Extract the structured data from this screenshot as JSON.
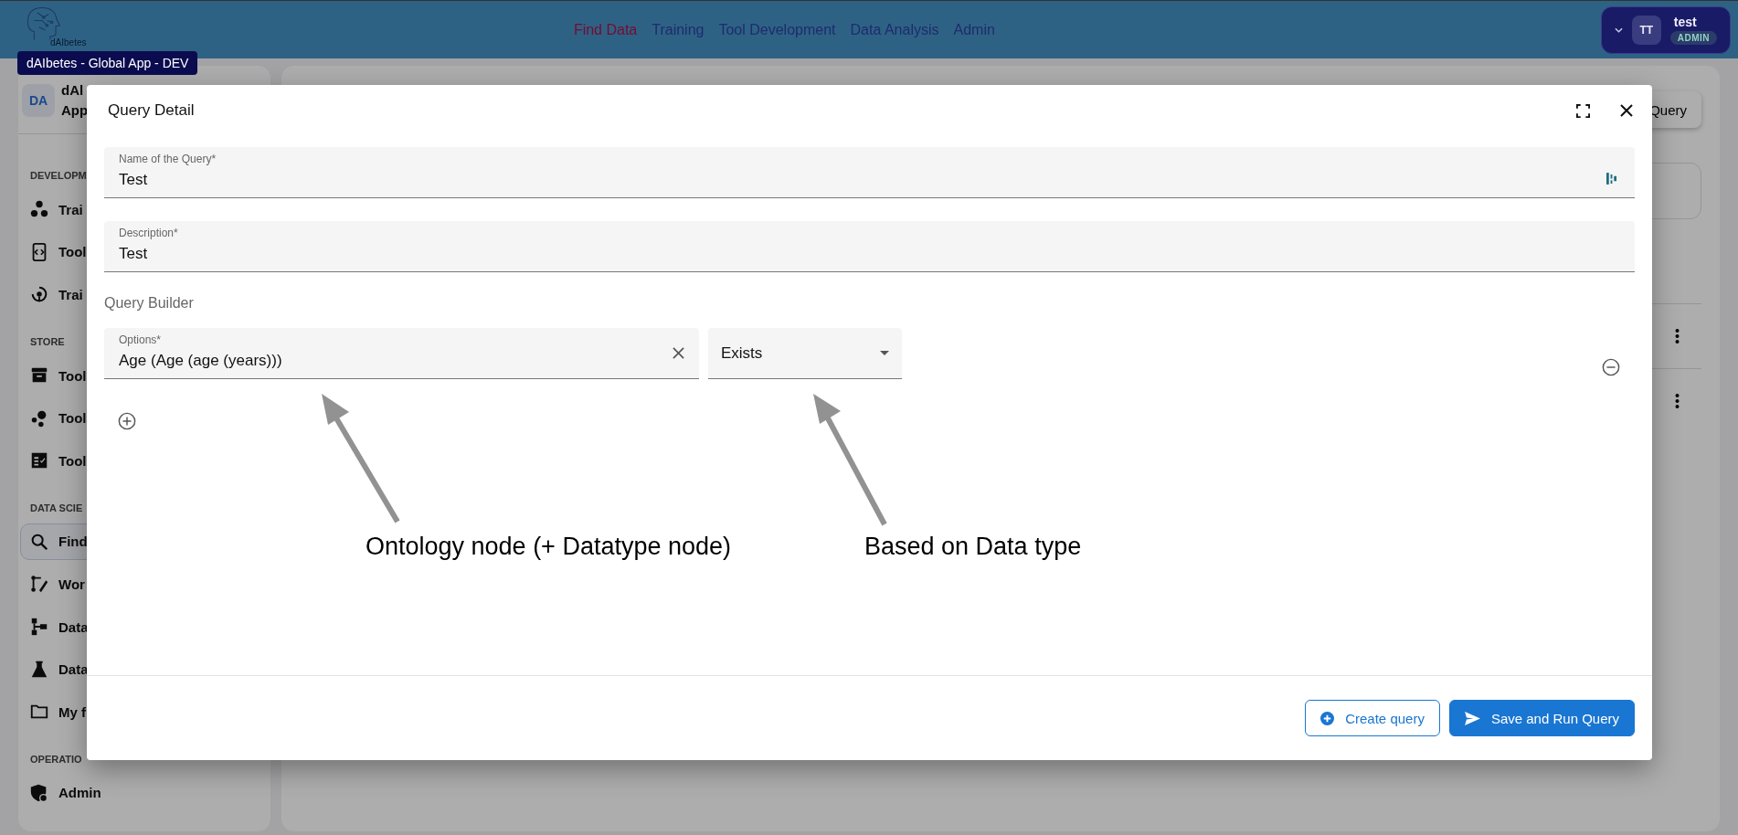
{
  "header": {
    "logo_caption": "dAIbetes",
    "nav": [
      {
        "label": "Find Data",
        "selected": true
      },
      {
        "label": "Training",
        "selected": false
      },
      {
        "label": "Tool Development",
        "selected": false
      },
      {
        "label": "Data Analysis",
        "selected": false
      },
      {
        "label": "Admin",
        "selected": false
      }
    ],
    "user": {
      "initials": "TT",
      "name": "test",
      "role": "ADMIN"
    }
  },
  "tooltip": "dAIbetes - Global App - DEV",
  "sidebar": {
    "avatar": "DA",
    "title_lines": [
      "dAl",
      "App"
    ],
    "sections": [
      {
        "heading": "DEVELOPM",
        "items": [
          {
            "label": "Trai",
            "kind": "cluster",
            "selected": false
          },
          {
            "label": "Tool",
            "kind": "code",
            "selected": false
          },
          {
            "label": "Trai",
            "kind": "cycle",
            "selected": false
          }
        ]
      },
      {
        "heading": "STORE",
        "items": [
          {
            "label": "Tool",
            "kind": "archive",
            "selected": false
          },
          {
            "label": "Tool",
            "kind": "bubbles",
            "selected": false
          },
          {
            "label": "Tool",
            "kind": "checklist",
            "selected": false
          }
        ]
      },
      {
        "heading": "DATA SCIE",
        "items": [
          {
            "label": "Find",
            "kind": "search",
            "selected": true
          },
          {
            "label": "Wor",
            "kind": "workflow",
            "selected": false
          },
          {
            "label": "Data",
            "kind": "tree",
            "selected": false
          },
          {
            "label": "Data",
            "kind": "flask",
            "selected": false
          },
          {
            "label": "My f",
            "kind": "folder",
            "selected": false
          }
        ]
      },
      {
        "heading": "OPERATIO",
        "items": [
          {
            "label": "Admin",
            "kind": "shield",
            "selected": false
          }
        ]
      }
    ]
  },
  "main": {
    "query_button": "Query"
  },
  "dialog": {
    "title": "Query Detail",
    "fields": [
      {
        "label": "Name of the Query*",
        "value": "Test"
      },
      {
        "label": "Description*",
        "value": "Test"
      }
    ],
    "builder_heading": "Query Builder",
    "option_field": {
      "label": "Options*",
      "value": "Age (Age (age (years)))"
    },
    "operator_select": {
      "value": "Exists"
    },
    "annotations": [
      "Ontology node (+ Datatype node)",
      "Based on Data type"
    ],
    "buttons": [
      {
        "label": "Create query",
        "kind": "outlined"
      },
      {
        "label": "Save and Run Query",
        "kind": "filled"
      }
    ]
  }
}
